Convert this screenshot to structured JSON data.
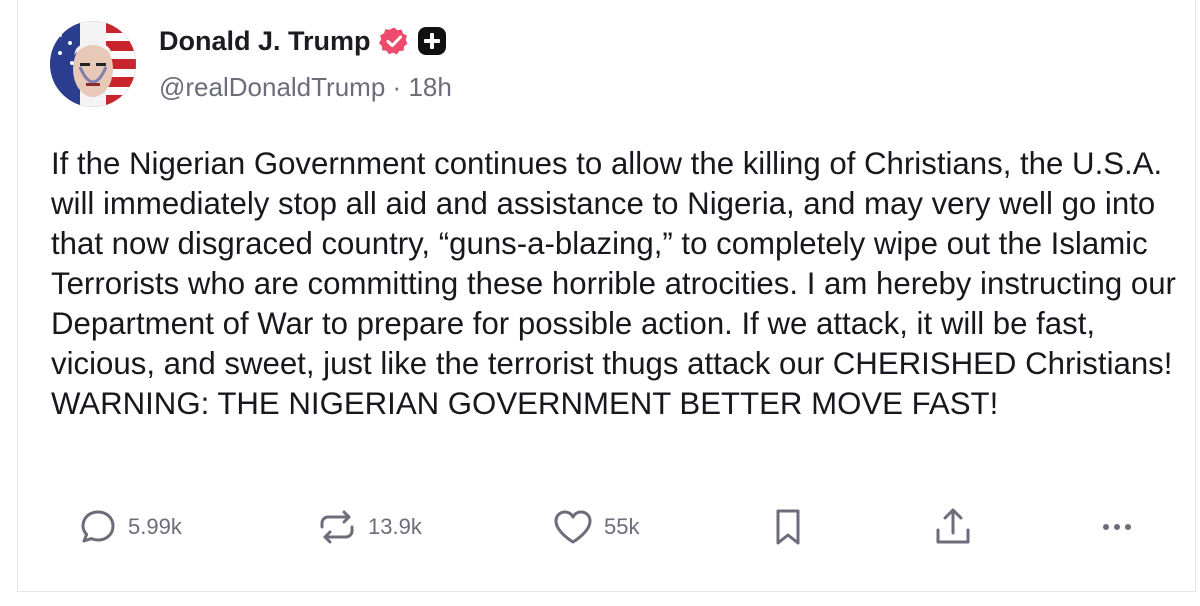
{
  "post": {
    "author": {
      "display_name": "Donald J. Trump",
      "handle": "@realDonaldTrump",
      "separator": "·",
      "time": "18h",
      "verified_color": "#ec4b6c",
      "plus_badge_color": "#111111"
    },
    "text": "If the Nigerian Government continues to allow the killing of Christians, the U.S.A. will immediately stop all aid and assistance to Nigeria, and may very well go into that now disgraced country, “guns-a-blazing,” to completely wipe out the Islamic Terrorists who are committing these horrible atrocities. I am hereby instructing our Department of War to prepare for possible action. If we attack, it will be fast, vicious, and sweet, just like the terrorist thugs attack our CHERISHED Christians! WARNING: THE NIGERIAN GOVERNMENT BETTER MOVE FAST!",
    "actions": {
      "replies": {
        "icon": "reply-icon",
        "count": "5.99k"
      },
      "reposts": {
        "icon": "repost-icon",
        "count": "13.9k"
      },
      "likes": {
        "icon": "heart-icon",
        "count": "55k"
      },
      "bookmark": {
        "icon": "bookmark-icon"
      },
      "share": {
        "icon": "share-icon"
      },
      "more": {
        "icon": "more-icon"
      }
    }
  },
  "colors": {
    "text_primary": "#17171d",
    "text_secondary": "#6c6c7a",
    "border": "#e6e6e9",
    "icon": "#6c6c7a"
  }
}
